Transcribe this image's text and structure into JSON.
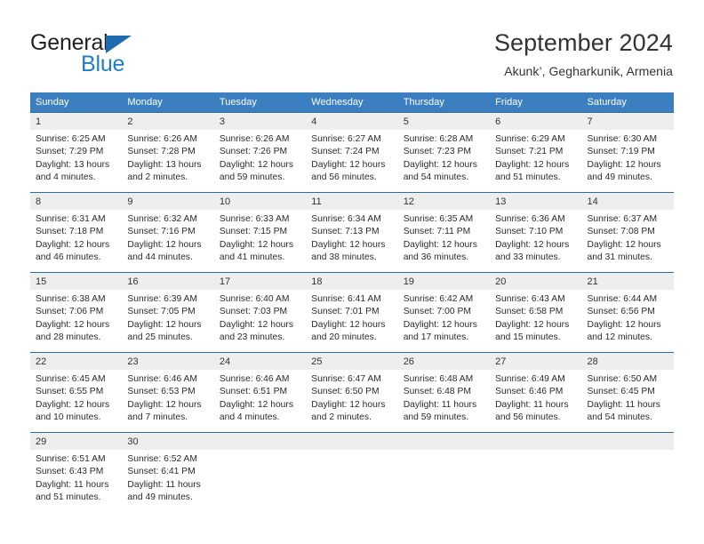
{
  "brand": {
    "name_part1": "General",
    "name_part2": "Blue",
    "triangle_icon": "triangle-icon",
    "accent_color": "#1f7ec4",
    "dark_color": "#231f20"
  },
  "header": {
    "title": "September 2024",
    "subtitle": "Akunk’, Gegharkunik, Armenia"
  },
  "theme": {
    "header_bg": "#3c7fc1",
    "row_rule": "#2e6ca4",
    "daynum_band": "#eeeeee"
  },
  "weekdays": [
    "Sunday",
    "Monday",
    "Tuesday",
    "Wednesday",
    "Thursday",
    "Friday",
    "Saturday"
  ],
  "weeks": [
    [
      {
        "day": "1",
        "sunrise": "Sunrise: 6:25 AM",
        "sunset": "Sunset: 7:29 PM",
        "daylight1": "Daylight: 13 hours",
        "daylight2": "and 4 minutes."
      },
      {
        "day": "2",
        "sunrise": "Sunrise: 6:26 AM",
        "sunset": "Sunset: 7:28 PM",
        "daylight1": "Daylight: 13 hours",
        "daylight2": "and 2 minutes."
      },
      {
        "day": "3",
        "sunrise": "Sunrise: 6:26 AM",
        "sunset": "Sunset: 7:26 PM",
        "daylight1": "Daylight: 12 hours",
        "daylight2": "and 59 minutes."
      },
      {
        "day": "4",
        "sunrise": "Sunrise: 6:27 AM",
        "sunset": "Sunset: 7:24 PM",
        "daylight1": "Daylight: 12 hours",
        "daylight2": "and 56 minutes."
      },
      {
        "day": "5",
        "sunrise": "Sunrise: 6:28 AM",
        "sunset": "Sunset: 7:23 PM",
        "daylight1": "Daylight: 12 hours",
        "daylight2": "and 54 minutes."
      },
      {
        "day": "6",
        "sunrise": "Sunrise: 6:29 AM",
        "sunset": "Sunset: 7:21 PM",
        "daylight1": "Daylight: 12 hours",
        "daylight2": "and 51 minutes."
      },
      {
        "day": "7",
        "sunrise": "Sunrise: 6:30 AM",
        "sunset": "Sunset: 7:19 PM",
        "daylight1": "Daylight: 12 hours",
        "daylight2": "and 49 minutes."
      }
    ],
    [
      {
        "day": "8",
        "sunrise": "Sunrise: 6:31 AM",
        "sunset": "Sunset: 7:18 PM",
        "daylight1": "Daylight: 12 hours",
        "daylight2": "and 46 minutes."
      },
      {
        "day": "9",
        "sunrise": "Sunrise: 6:32 AM",
        "sunset": "Sunset: 7:16 PM",
        "daylight1": "Daylight: 12 hours",
        "daylight2": "and 44 minutes."
      },
      {
        "day": "10",
        "sunrise": "Sunrise: 6:33 AM",
        "sunset": "Sunset: 7:15 PM",
        "daylight1": "Daylight: 12 hours",
        "daylight2": "and 41 minutes."
      },
      {
        "day": "11",
        "sunrise": "Sunrise: 6:34 AM",
        "sunset": "Sunset: 7:13 PM",
        "daylight1": "Daylight: 12 hours",
        "daylight2": "and 38 minutes."
      },
      {
        "day": "12",
        "sunrise": "Sunrise: 6:35 AM",
        "sunset": "Sunset: 7:11 PM",
        "daylight1": "Daylight: 12 hours",
        "daylight2": "and 36 minutes."
      },
      {
        "day": "13",
        "sunrise": "Sunrise: 6:36 AM",
        "sunset": "Sunset: 7:10 PM",
        "daylight1": "Daylight: 12 hours",
        "daylight2": "and 33 minutes."
      },
      {
        "day": "14",
        "sunrise": "Sunrise: 6:37 AM",
        "sunset": "Sunset: 7:08 PM",
        "daylight1": "Daylight: 12 hours",
        "daylight2": "and 31 minutes."
      }
    ],
    [
      {
        "day": "15",
        "sunrise": "Sunrise: 6:38 AM",
        "sunset": "Sunset: 7:06 PM",
        "daylight1": "Daylight: 12 hours",
        "daylight2": "and 28 minutes."
      },
      {
        "day": "16",
        "sunrise": "Sunrise: 6:39 AM",
        "sunset": "Sunset: 7:05 PM",
        "daylight1": "Daylight: 12 hours",
        "daylight2": "and 25 minutes."
      },
      {
        "day": "17",
        "sunrise": "Sunrise: 6:40 AM",
        "sunset": "Sunset: 7:03 PM",
        "daylight1": "Daylight: 12 hours",
        "daylight2": "and 23 minutes."
      },
      {
        "day": "18",
        "sunrise": "Sunrise: 6:41 AM",
        "sunset": "Sunset: 7:01 PM",
        "daylight1": "Daylight: 12 hours",
        "daylight2": "and 20 minutes."
      },
      {
        "day": "19",
        "sunrise": "Sunrise: 6:42 AM",
        "sunset": "Sunset: 7:00 PM",
        "daylight1": "Daylight: 12 hours",
        "daylight2": "and 17 minutes."
      },
      {
        "day": "20",
        "sunrise": "Sunrise: 6:43 AM",
        "sunset": "Sunset: 6:58 PM",
        "daylight1": "Daylight: 12 hours",
        "daylight2": "and 15 minutes."
      },
      {
        "day": "21",
        "sunrise": "Sunrise: 6:44 AM",
        "sunset": "Sunset: 6:56 PM",
        "daylight1": "Daylight: 12 hours",
        "daylight2": "and 12 minutes."
      }
    ],
    [
      {
        "day": "22",
        "sunrise": "Sunrise: 6:45 AM",
        "sunset": "Sunset: 6:55 PM",
        "daylight1": "Daylight: 12 hours",
        "daylight2": "and 10 minutes."
      },
      {
        "day": "23",
        "sunrise": "Sunrise: 6:46 AM",
        "sunset": "Sunset: 6:53 PM",
        "daylight1": "Daylight: 12 hours",
        "daylight2": "and 7 minutes."
      },
      {
        "day": "24",
        "sunrise": "Sunrise: 6:46 AM",
        "sunset": "Sunset: 6:51 PM",
        "daylight1": "Daylight: 12 hours",
        "daylight2": "and 4 minutes."
      },
      {
        "day": "25",
        "sunrise": "Sunrise: 6:47 AM",
        "sunset": "Sunset: 6:50 PM",
        "daylight1": "Daylight: 12 hours",
        "daylight2": "and 2 minutes."
      },
      {
        "day": "26",
        "sunrise": "Sunrise: 6:48 AM",
        "sunset": "Sunset: 6:48 PM",
        "daylight1": "Daylight: 11 hours",
        "daylight2": "and 59 minutes."
      },
      {
        "day": "27",
        "sunrise": "Sunrise: 6:49 AM",
        "sunset": "Sunset: 6:46 PM",
        "daylight1": "Daylight: 11 hours",
        "daylight2": "and 56 minutes."
      },
      {
        "day": "28",
        "sunrise": "Sunrise: 6:50 AM",
        "sunset": "Sunset: 6:45 PM",
        "daylight1": "Daylight: 11 hours",
        "daylight2": "and 54 minutes."
      }
    ],
    [
      {
        "day": "29",
        "sunrise": "Sunrise: 6:51 AM",
        "sunset": "Sunset: 6:43 PM",
        "daylight1": "Daylight: 11 hours",
        "daylight2": "and 51 minutes."
      },
      {
        "day": "30",
        "sunrise": "Sunrise: 6:52 AM",
        "sunset": "Sunset: 6:41 PM",
        "daylight1": "Daylight: 11 hours",
        "daylight2": "and 49 minutes."
      },
      {
        "day": "",
        "sunrise": "",
        "sunset": "",
        "daylight1": "",
        "daylight2": ""
      },
      {
        "day": "",
        "sunrise": "",
        "sunset": "",
        "daylight1": "",
        "daylight2": ""
      },
      {
        "day": "",
        "sunrise": "",
        "sunset": "",
        "daylight1": "",
        "daylight2": ""
      },
      {
        "day": "",
        "sunrise": "",
        "sunset": "",
        "daylight1": "",
        "daylight2": ""
      },
      {
        "day": "",
        "sunrise": "",
        "sunset": "",
        "daylight1": "",
        "daylight2": ""
      }
    ]
  ]
}
